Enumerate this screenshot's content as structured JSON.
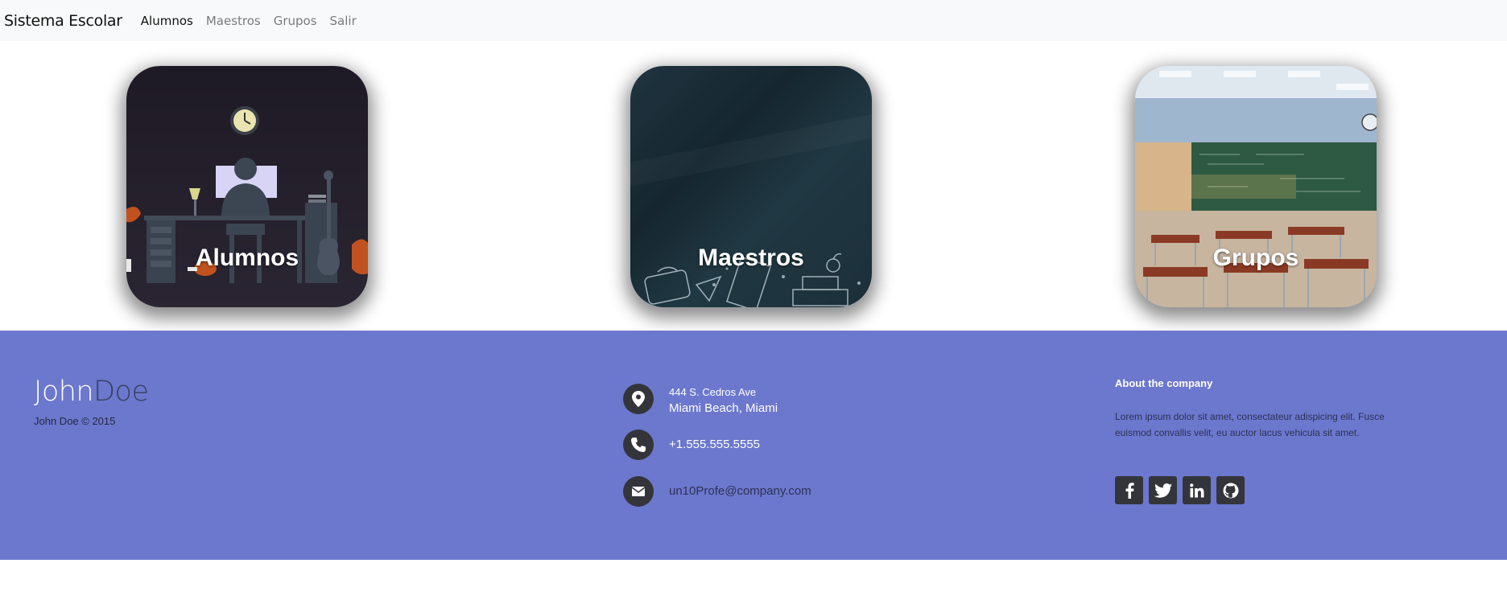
{
  "navbar": {
    "brand": "Sistema Escolar",
    "links": [
      {
        "label": "Alumnos",
        "active": true
      },
      {
        "label": "Maestros",
        "active": false
      },
      {
        "label": "Grupos",
        "active": false
      },
      {
        "label": "Salir",
        "active": false
      }
    ]
  },
  "cards": [
    {
      "label": "Alumnos",
      "image": "desk-silhouette-illustration"
    },
    {
      "label": "Maestros",
      "image": "chalkboard-school-doodles"
    },
    {
      "label": "Grupos",
      "image": "classroom-photo"
    }
  ],
  "footer": {
    "logo_first": "John",
    "logo_second": "Doe",
    "copyright": "John Doe © 2015",
    "address_line1": "444 S. Cedros Ave",
    "address_line2": "Miami Beach, Miami",
    "phone": "+1.555.555.5555",
    "email": "un10Profe@company.com",
    "about_title": "About the company",
    "about_text": "Lorem ipsum dolor sit amet, consectateur adispicing elit. Fusce euismod convallis velit, eu auctor lacus vehicula sit amet.",
    "socials": [
      "facebook-icon",
      "twitter-icon",
      "linkedin-icon",
      "github-icon"
    ]
  },
  "colors": {
    "navbar_bg": "#f8f9fa",
    "footer_bg": "#6c78cd",
    "icon_bg": "#33353b",
    "logo_accent": "#38405f"
  }
}
